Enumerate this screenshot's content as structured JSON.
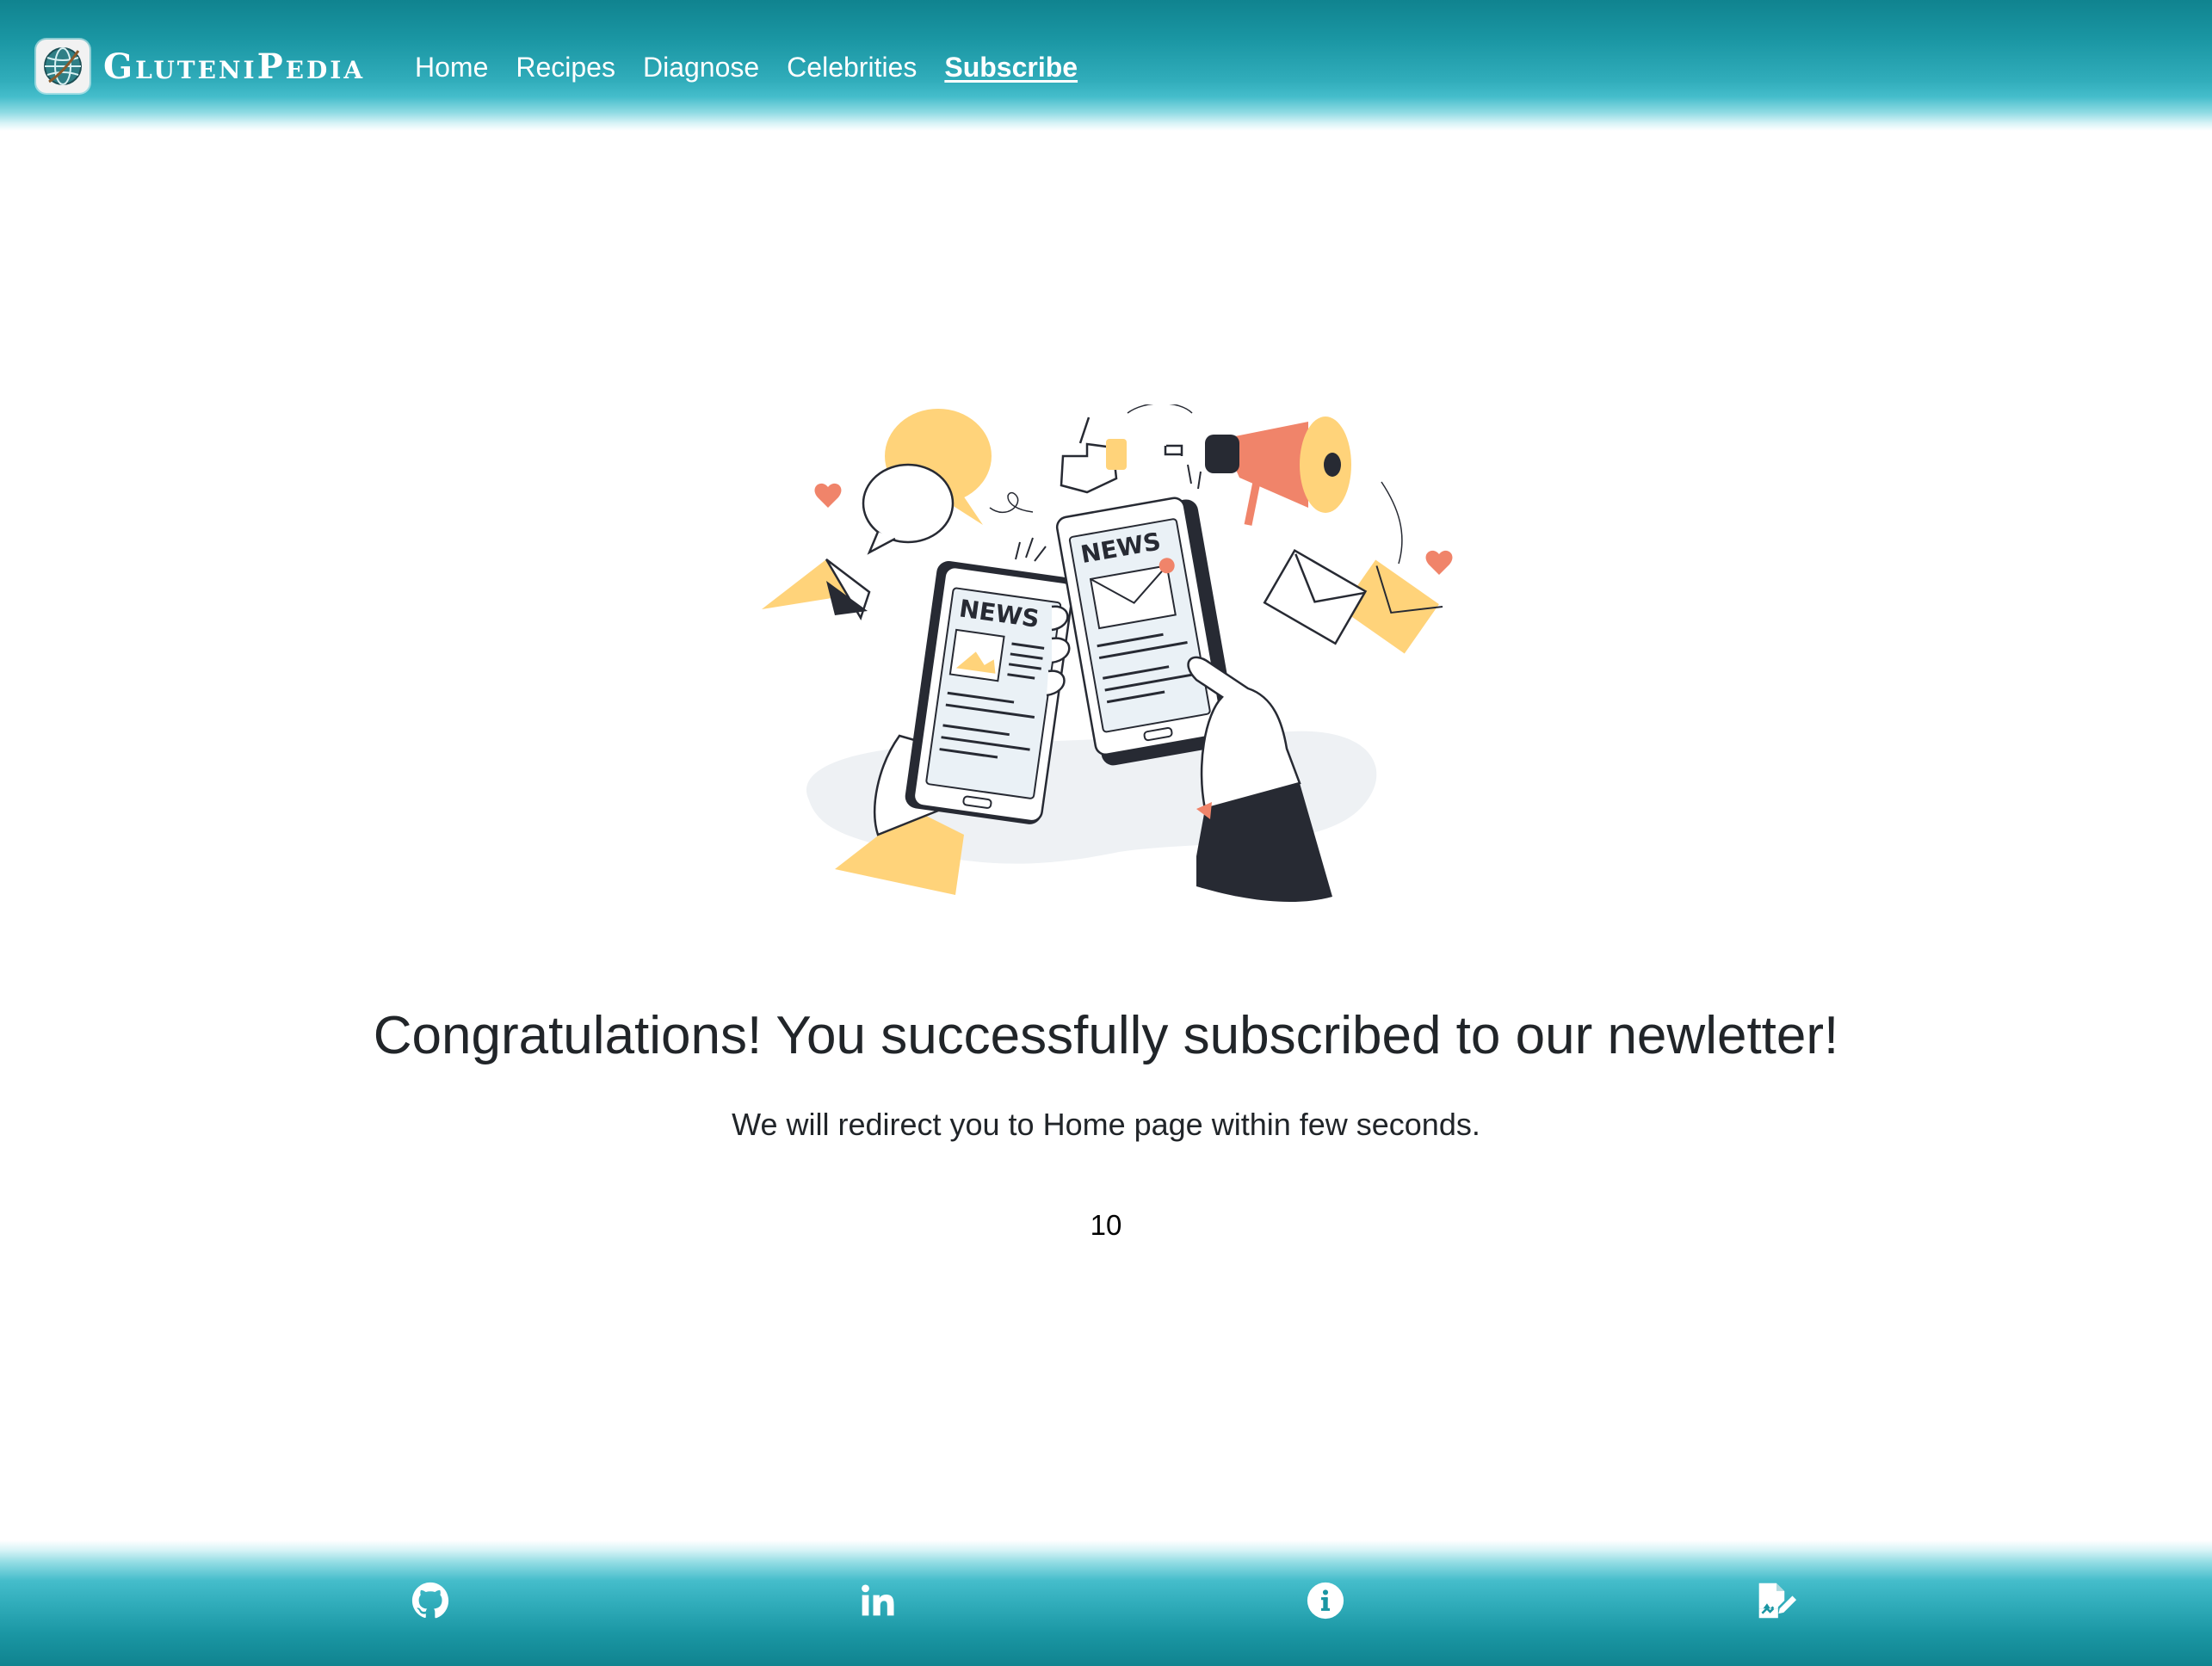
{
  "brand": {
    "name": "GluteniPedia",
    "logo_icon": "globe-logo-icon"
  },
  "nav": {
    "items": [
      {
        "label": "Home",
        "active": false
      },
      {
        "label": "Recipes",
        "active": false
      },
      {
        "label": "Diagnose",
        "active": false
      },
      {
        "label": "Celebrities",
        "active": false
      },
      {
        "label": "Subscribe",
        "active": true
      }
    ]
  },
  "illustration": {
    "left_phone_label": "NEWS",
    "right_phone_label": "NEWS",
    "icon": "newsletter-illustration"
  },
  "main": {
    "headline": "Congratulations! You successfully subscribed to our newletter!",
    "subtext": "We will redirect you to Home page within few seconds.",
    "countdown": "10"
  },
  "footer": {
    "icons": [
      "github-icon",
      "linkedin-icon",
      "info-icon",
      "signed-document-icon"
    ]
  },
  "colors": {
    "header_teal_dark": "#10838f",
    "header_teal_light": "#45bdcb",
    "accent_yellow": "#ffd37a",
    "accent_coral": "#f0846a",
    "ink": "#272a33"
  }
}
